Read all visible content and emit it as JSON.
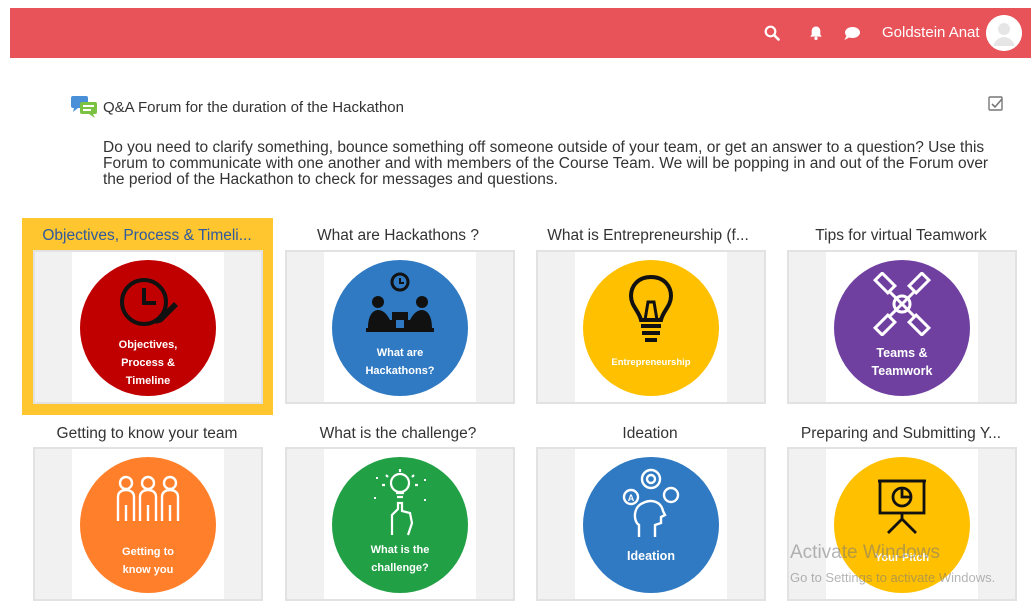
{
  "header": {
    "user_name": "Goldstein Anat",
    "icons": [
      "search-icon",
      "bell-icon",
      "chat-icon"
    ]
  },
  "forum": {
    "title": "Q&A Forum for the duration of the Hackathon",
    "description": "Do you need to clarify something, bounce something off someone outside of your team, or get an answer to a question? Use this Forum to communicate with one another and with members of the Course Team.  We will be popping in and out of the Forum over the period of the Hackathon to check for messages and questions."
  },
  "tiles": [
    {
      "title": "Objectives, Process & Timeli...",
      "circle_text": "Objectives,\nProcess &\nTimeline",
      "color": "#c00000",
      "icon": "clock-pencil-icon"
    },
    {
      "title": "What are Hackathons ?",
      "circle_text": "What are\nHackathons?",
      "color": "#2f7ac2",
      "icon": "people-laptop-icon"
    },
    {
      "title": "What is Entrepreneurship (f...",
      "circle_text": "Entrepreneurship",
      "color": "#ffc000",
      "icon": "lightbulb-icon"
    },
    {
      "title": "Tips for virtual Teamwork",
      "circle_text": "Teams &\nTeamwork",
      "color": "#7040a0",
      "icon": "handshake-icon"
    },
    {
      "title": "Getting to know your team",
      "circle_text": "Getting to\nknow you",
      "color": "#ff7f2a",
      "icon": "team-people-icon"
    },
    {
      "title": "What is the challenge?",
      "circle_text": "What is the\nchallenge?",
      "color": "#22a046",
      "icon": "idea-hand-icon"
    },
    {
      "title": "Ideation",
      "circle_text": "Ideation",
      "color": "#2f7ac2",
      "icon": "head-ideas-icon"
    },
    {
      "title": "Preparing and Submitting Y...",
      "circle_text": "Your Pitch",
      "color": "#ffc000",
      "icon": "presentation-board-icon"
    }
  ],
  "watermark": {
    "line1": "Activate Windows",
    "line2": "Go to Settings to activate Windows."
  }
}
